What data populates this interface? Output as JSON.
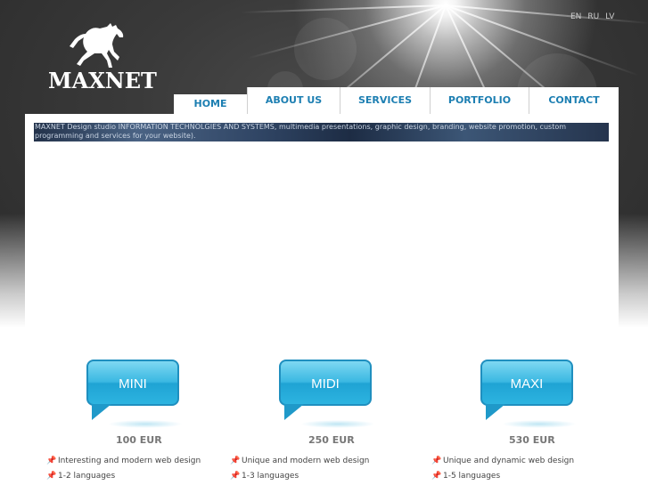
{
  "header": {
    "logo_text": "MAXNET",
    "languages": [
      "EN",
      "RU",
      "LV"
    ]
  },
  "nav": {
    "tabs": [
      {
        "label": "HOME",
        "active": true
      },
      {
        "label": "ABOUT US",
        "active": false
      },
      {
        "label": "SERVICES",
        "active": false
      },
      {
        "label": "PORTFOLIO",
        "active": false
      },
      {
        "label": "CONTACT",
        "active": false
      }
    ]
  },
  "banner": {
    "text": "MAXNET Design studio INFORMATION TECHNOLGIES AND SYSTEMS, multimedia presentations, graphic design, branding, website promotion, custom programming and services for your website)."
  },
  "plans": [
    {
      "name": "MINI",
      "price": "100 EUR",
      "features": [
        "Interesting and modern web design",
        "1-2 languages"
      ]
    },
    {
      "name": "MIDI",
      "price": "250 EUR",
      "features": [
        "Unique and modern web design",
        "1-3 languages"
      ]
    },
    {
      "name": "MAXI",
      "price": "530 EUR",
      "features": [
        "Unique and dynamic web design",
        "1-5 languages"
      ]
    }
  ],
  "colors": {
    "tab_text": "#1d7fb2",
    "bubble": "#3ab8e2",
    "price": "#777777"
  },
  "icons": {
    "feature_bullet": "pushpin-icon"
  }
}
